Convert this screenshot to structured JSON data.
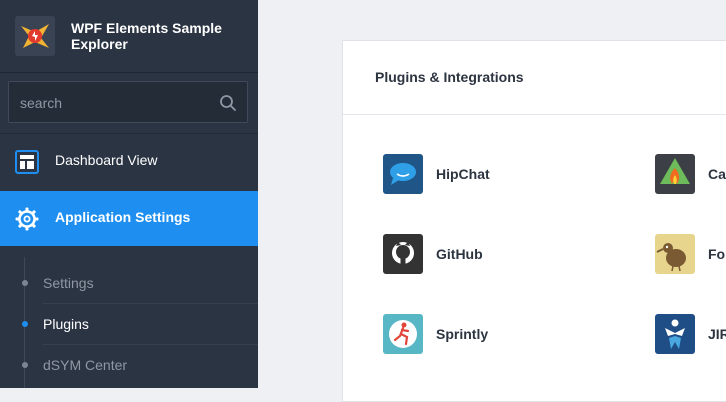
{
  "app": {
    "title": "WPF Elements Sample Explorer",
    "logo_icon": "app-logo-icon"
  },
  "search": {
    "placeholder": "search",
    "icon": "search-icon"
  },
  "nav": [
    {
      "label": "Dashboard View",
      "icon": "dashboard-icon",
      "active": false
    },
    {
      "label": "Application Settings",
      "icon": "gear-icon",
      "active": true
    }
  ],
  "subnav": [
    {
      "label": "Settings",
      "current": false
    },
    {
      "label": "Plugins",
      "current": true
    },
    {
      "label": "dSYM Center",
      "current": false
    }
  ],
  "panel": {
    "title": "Plugins & Integrations",
    "plugins": [
      {
        "name": "HipChat",
        "icon": "hipchat-icon"
      },
      {
        "name": "Ca",
        "icon": "campfire-icon"
      },
      {
        "name": "GitHub",
        "icon": "github-icon"
      },
      {
        "name": "Fo",
        "icon": "fogbugz-icon"
      },
      {
        "name": "Sprintly",
        "icon": "sprintly-icon"
      },
      {
        "name": "JIR",
        "icon": "jira-icon"
      }
    ]
  },
  "colors": {
    "sidebar_bg": "#2b3443",
    "accent": "#1e8ff0",
    "page_bg": "#eef0f3",
    "panel_bg": "#ffffff"
  }
}
